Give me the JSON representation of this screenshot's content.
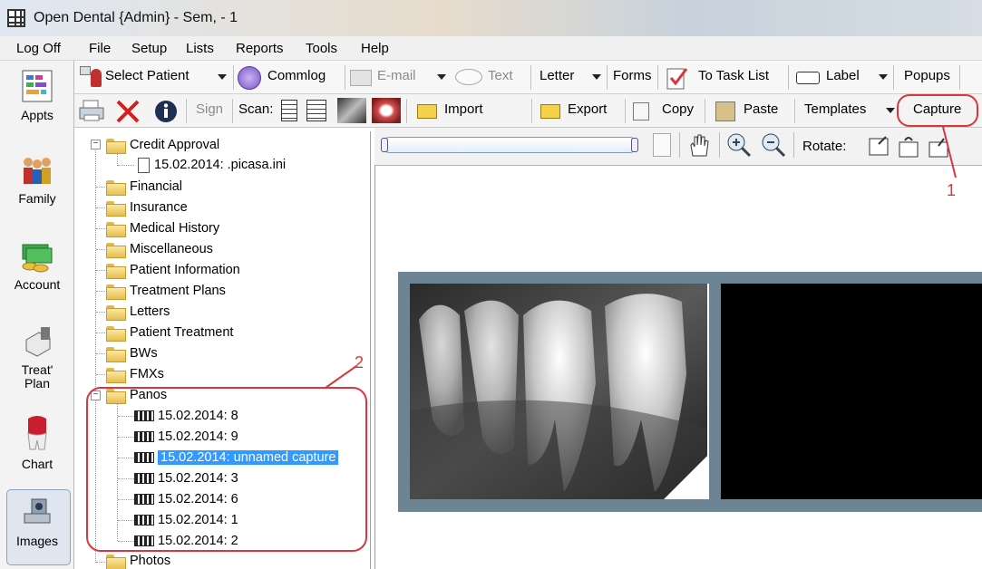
{
  "window": {
    "title": "Open Dental {Admin} - Sem, - 1"
  },
  "menu": [
    "Log Off",
    "File",
    "Setup",
    "Lists",
    "Reports",
    "Tools",
    "Help"
  ],
  "modules": [
    {
      "label": "Appts",
      "icon": "appointments-icon"
    },
    {
      "label": "Family",
      "icon": "family-icon"
    },
    {
      "label": "Account",
      "icon": "account-icon"
    },
    {
      "label": "Treat'\nPlan",
      "icon": "treatment-plan-icon"
    },
    {
      "label": "Chart",
      "icon": "chart-icon"
    },
    {
      "label": "Images",
      "icon": "images-icon"
    }
  ],
  "toolbar1": {
    "select_patient": "Select Patient",
    "commlog": "Commlog",
    "email": "E-mail",
    "text": "Text",
    "letter": "Letter",
    "forms": "Forms",
    "to_task_list": "To Task List",
    "label": "Label",
    "popups": "Popups"
  },
  "toolbar2": {
    "sign": "Sign",
    "scan": "Scan:",
    "import": "Import",
    "export": "Export",
    "copy": "Copy",
    "paste": "Paste",
    "templates": "Templates",
    "capture": "Capture"
  },
  "viewer_toolbar": {
    "rotate": "Rotate:"
  },
  "tree": {
    "credit_approval": "Credit Approval",
    "credit_doc": "15.02.2014: .picasa.ini",
    "folders": [
      "Financial",
      "Insurance",
      "Medical History",
      "Miscellaneous",
      "Patient Information",
      "Treatment Plans",
      "Letters",
      "Patient Treatment",
      "BWs",
      "FMXs"
    ],
    "panos": "Panos",
    "pano_items": [
      "15.02.2014: 8",
      "15.02.2014: 9",
      "15.02.2014: unnamed capture",
      "15.02.2014: 3",
      "15.02.2014: 6",
      "15.02.2014: 1",
      "15.02.2014: 2"
    ],
    "photos": "Photos"
  },
  "annotations": {
    "one": "1",
    "two": "2"
  },
  "colors": {
    "callout": "#d9363e",
    "selection": "#3399ff",
    "xray_frame": "#6d8494"
  }
}
